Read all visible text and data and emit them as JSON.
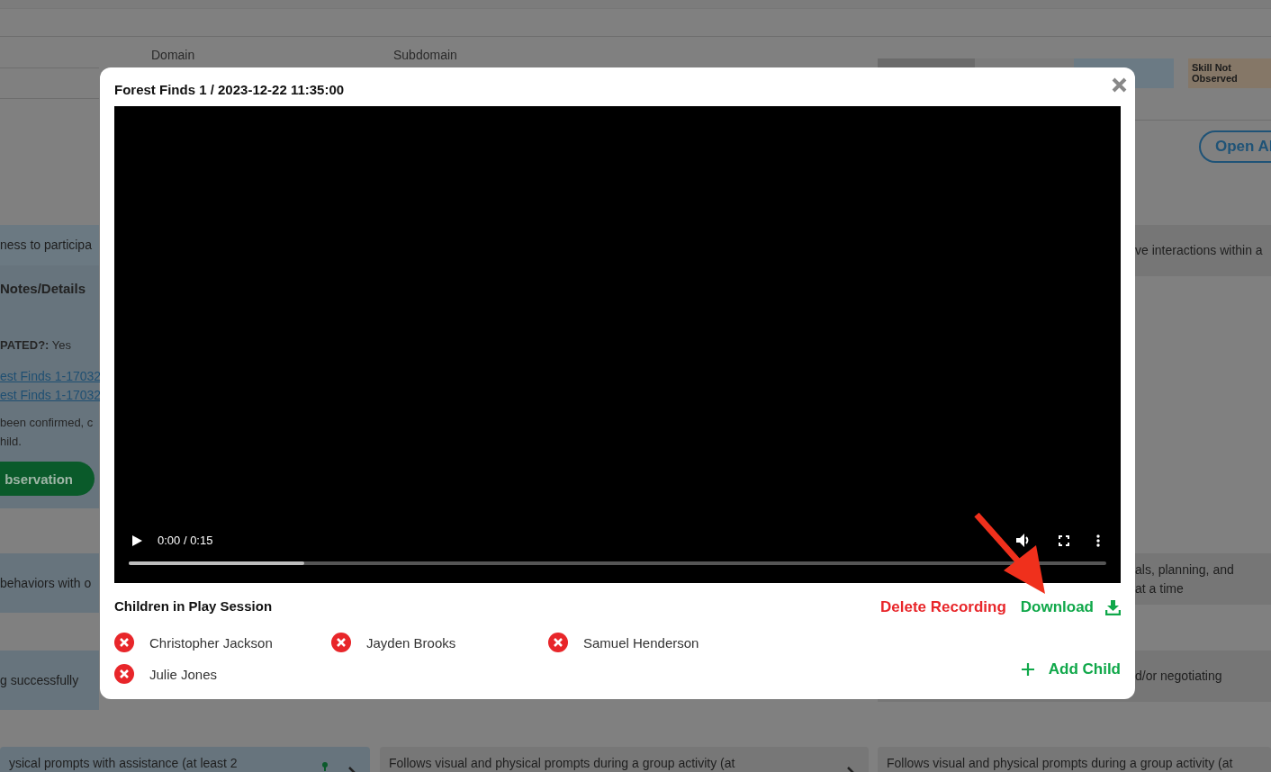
{
  "background": {
    "columns": [
      "Domain",
      "Subdomain"
    ],
    "legend": [
      {
        "color": "#6b6b6b"
      },
      {
        "color": "#7b7b7b"
      },
      {
        "color": "#6b7a84"
      },
      {
        "label": "Skill Not Observed",
        "color": "#857767"
      }
    ],
    "open_all_button": "Open Al",
    "left_panel": {
      "first_row": "ness to participa",
      "heading": "Notes/Details",
      "field": {
        "name": "PATED?:",
        "value": "Yes"
      },
      "links": [
        "est Finds 1-17032",
        "est Finds 1-17032"
      ],
      "note_lines": [
        "been confirmed, c",
        "hild."
      ],
      "button": "bservation"
    },
    "left_rows": [
      "behaviors with o",
      "g successfully"
    ],
    "right_rows": [
      [
        "ve interactions within a"
      ],
      [
        "als, planning, and",
        "at a time"
      ],
      [
        "d/or negotiating"
      ]
    ],
    "bottom_cards": [
      "ysical prompts with assistance (at least 2",
      "Follows visual and physical prompts during a group activity (at",
      "Follows visual and physical prompts during a group activity (at"
    ]
  },
  "modal": {
    "title": "Forest Finds 1 / 2023-12-22 11:35:00",
    "video": {
      "time": "0:00 / 0:15",
      "level": 0.18
    },
    "children_heading": "Children in Play Session",
    "children": [
      "Christopher Jackson",
      "Jayden Brooks",
      "Samuel Henderson",
      "Julie Jones"
    ],
    "delete_button": "Delete Recording",
    "download_button": "Download",
    "add_child_button": "Add Child"
  }
}
